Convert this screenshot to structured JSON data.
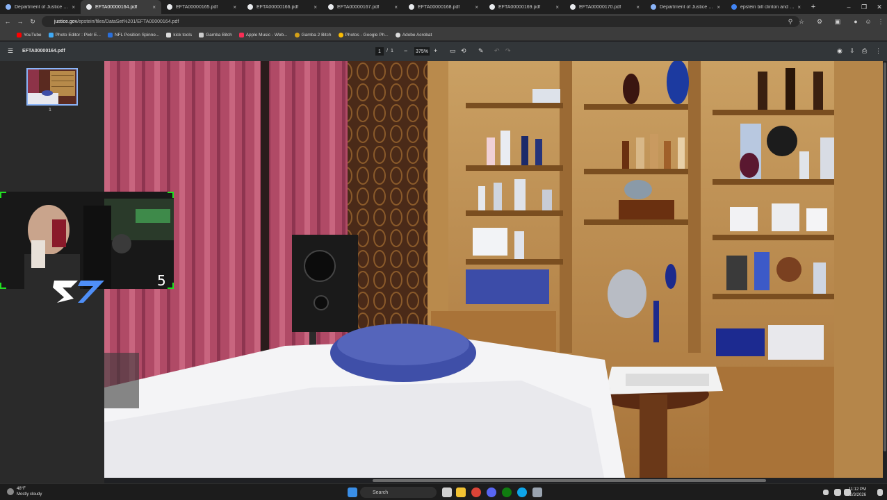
{
  "browser": {
    "tabs": [
      {
        "label": "Department of Justice | Data S",
        "active": false
      },
      {
        "label": "EFTA00000164.pdf",
        "active": true
      },
      {
        "label": "EFTA00000165.pdf",
        "active": false
      },
      {
        "label": "EFTA00000166.pdf",
        "active": false
      },
      {
        "label": "EFTA00000167.pdf",
        "active": false
      },
      {
        "label": "EFTA00000168.pdf",
        "active": false
      },
      {
        "label": "EFTA00000169.pdf",
        "active": false
      },
      {
        "label": "EFTA00000170.pdf",
        "active": false
      },
      {
        "label": "Department of Justice | Searc",
        "active": false
      },
      {
        "label": "epstein bill clinton and ghisla",
        "active": false
      }
    ],
    "tab_close_glyph": "×",
    "new_tab_glyph": "+",
    "url_host": "justice.gov",
    "url_path": "/epstein/files/DataSet%201/EFTA00000164.pdf",
    "bookmarks": [
      {
        "label": "YouTube",
        "color": "#ff0000"
      },
      {
        "label": "Photo Editor : Pixlr E...",
        "color": "#3fa9f5"
      },
      {
        "label": "NFL Position Spinne...",
        "color": "#2a6fdb"
      },
      {
        "label": "kick tools",
        "color": "#dddddd"
      },
      {
        "label": "Gamba Bitch",
        "color": "#cccccc"
      },
      {
        "label": "Apple Music - Web...",
        "color": "#fa2d55"
      },
      {
        "label": "Gamba 2 Bitch",
        "color": "#d4a017"
      },
      {
        "label": "Photos - Google Ph...",
        "color": "#fbbc04"
      },
      {
        "label": "Adobe Acrobat",
        "color": "#dddddd"
      }
    ]
  },
  "pdf_viewer": {
    "file_name": "EFTA00000164.pdf",
    "current_page": "1",
    "page_separator": "/",
    "total_pages": "1",
    "zoom": "375%",
    "zoom_out_glyph": "−",
    "zoom_in_glyph": "+",
    "thumbnail_page": "1"
  },
  "webcam": {
    "overlay_number": "5"
  },
  "taskbar": {
    "weather_temp": "48°F",
    "weather_desc": "Mostly cloudy",
    "search_placeholder": "Search",
    "time": "11:12 PM",
    "date": "2/3/2026"
  },
  "colors": {
    "accent": "#8ab4f8",
    "webcam_corner": "#21e021",
    "curtain": "#b04a66",
    "wood": "#c8954f",
    "towel": "#3f4fa8"
  }
}
